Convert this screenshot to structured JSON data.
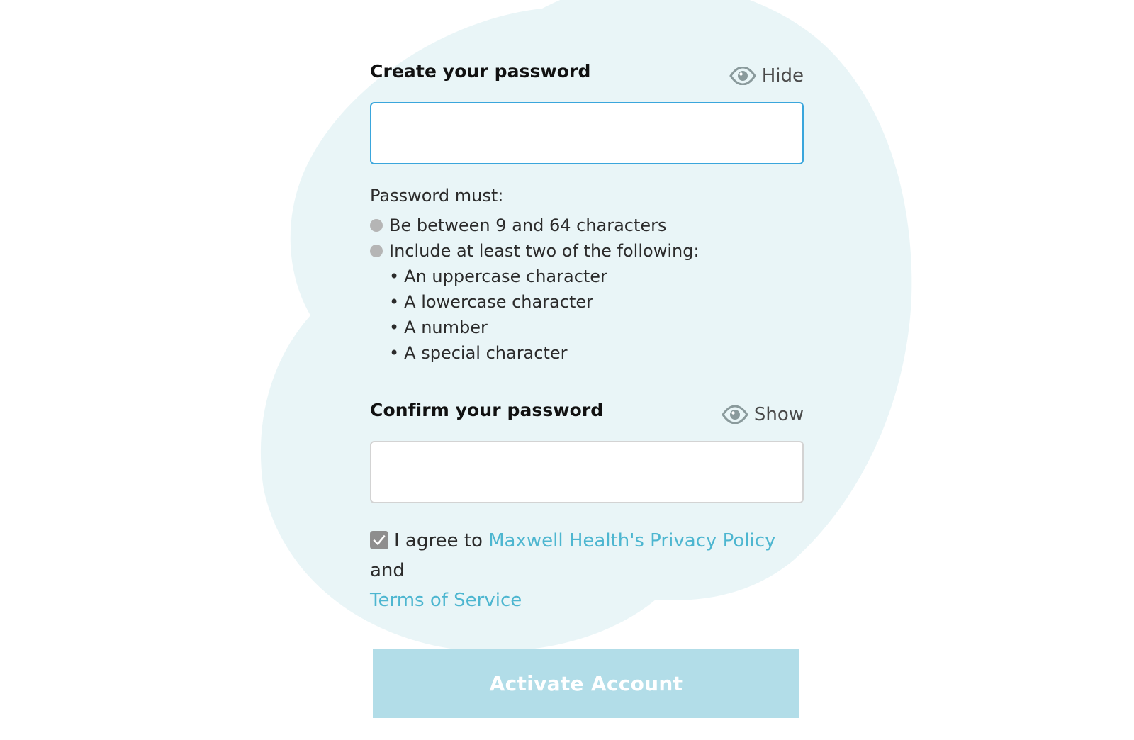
{
  "colors": {
    "blob": "#e9f5f7",
    "focus_border": "#3aa6dc",
    "link": "#4db6d0",
    "button_bg": "#b2dde8",
    "rule_dot": "#b5b5b5",
    "checkbox": "#8e8e8e"
  },
  "create_password": {
    "label": "Create your password",
    "toggle_label": "Hide",
    "toggle_icon": "eye-icon",
    "value": "",
    "placeholder": ""
  },
  "password_rules": {
    "title": "Password must:",
    "rules": [
      "Be between 9 and 64 characters",
      "Include at least two of the following:"
    ],
    "sub_rules": [
      "An uppercase character",
      "A lowercase character",
      "A number",
      "A special character"
    ],
    "sub_bullet": "•"
  },
  "confirm_password": {
    "label": "Confirm your password",
    "toggle_label": "Show",
    "toggle_icon": "eye-icon",
    "value": "",
    "placeholder": ""
  },
  "agreement": {
    "checked": true,
    "prefix": "I agree to ",
    "privacy_link": "Maxwell Health's Privacy Policy",
    "middle": " and",
    "terms_link": "Terms of Service"
  },
  "activate_button": {
    "label": "Activate Account"
  }
}
